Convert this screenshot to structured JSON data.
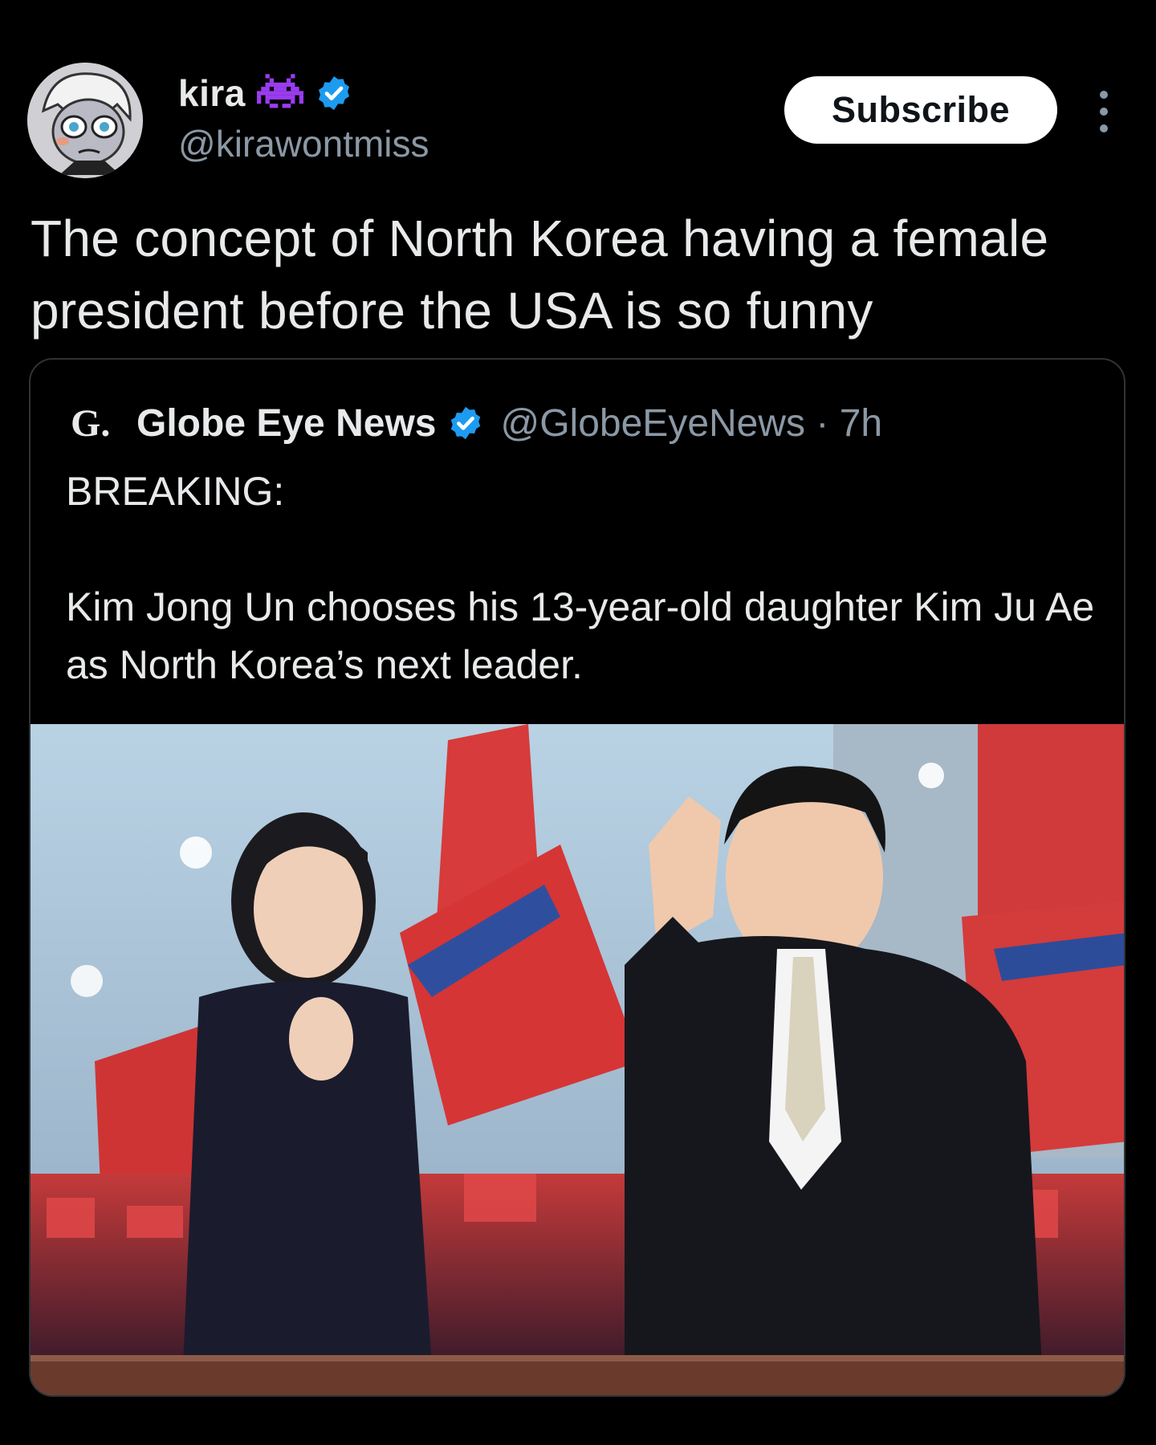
{
  "author": {
    "display_name": "kira",
    "handle": "@kirawontmiss",
    "badge_icon": "space-invader-icon",
    "verified_icon": "verified-badge-icon",
    "verified_color": "#1d9bf0"
  },
  "actions": {
    "subscribe_label": "Subscribe",
    "more_icon": "more-vertical-icon"
  },
  "tweet": {
    "text": "The concept of North Korea having a female president before the USA is so funny"
  },
  "quote": {
    "source_logo": "G.",
    "source_name": "Globe Eye News",
    "source_handle": "@GlobeEyeNews",
    "time": "7h",
    "text": "BREAKING:\n\nKim Jong Un chooses his 13-year-old daughter Kim Ju Ae as North Korea’s next leader.",
    "image": "photo-two-people-waving-red-flags-crowd"
  },
  "colors": {
    "background": "#000000",
    "text_primary": "#e7e9ea",
    "text_secondary": "#8b98a5",
    "border": "#2f3336",
    "badge_purple": "#9b3cf0"
  }
}
